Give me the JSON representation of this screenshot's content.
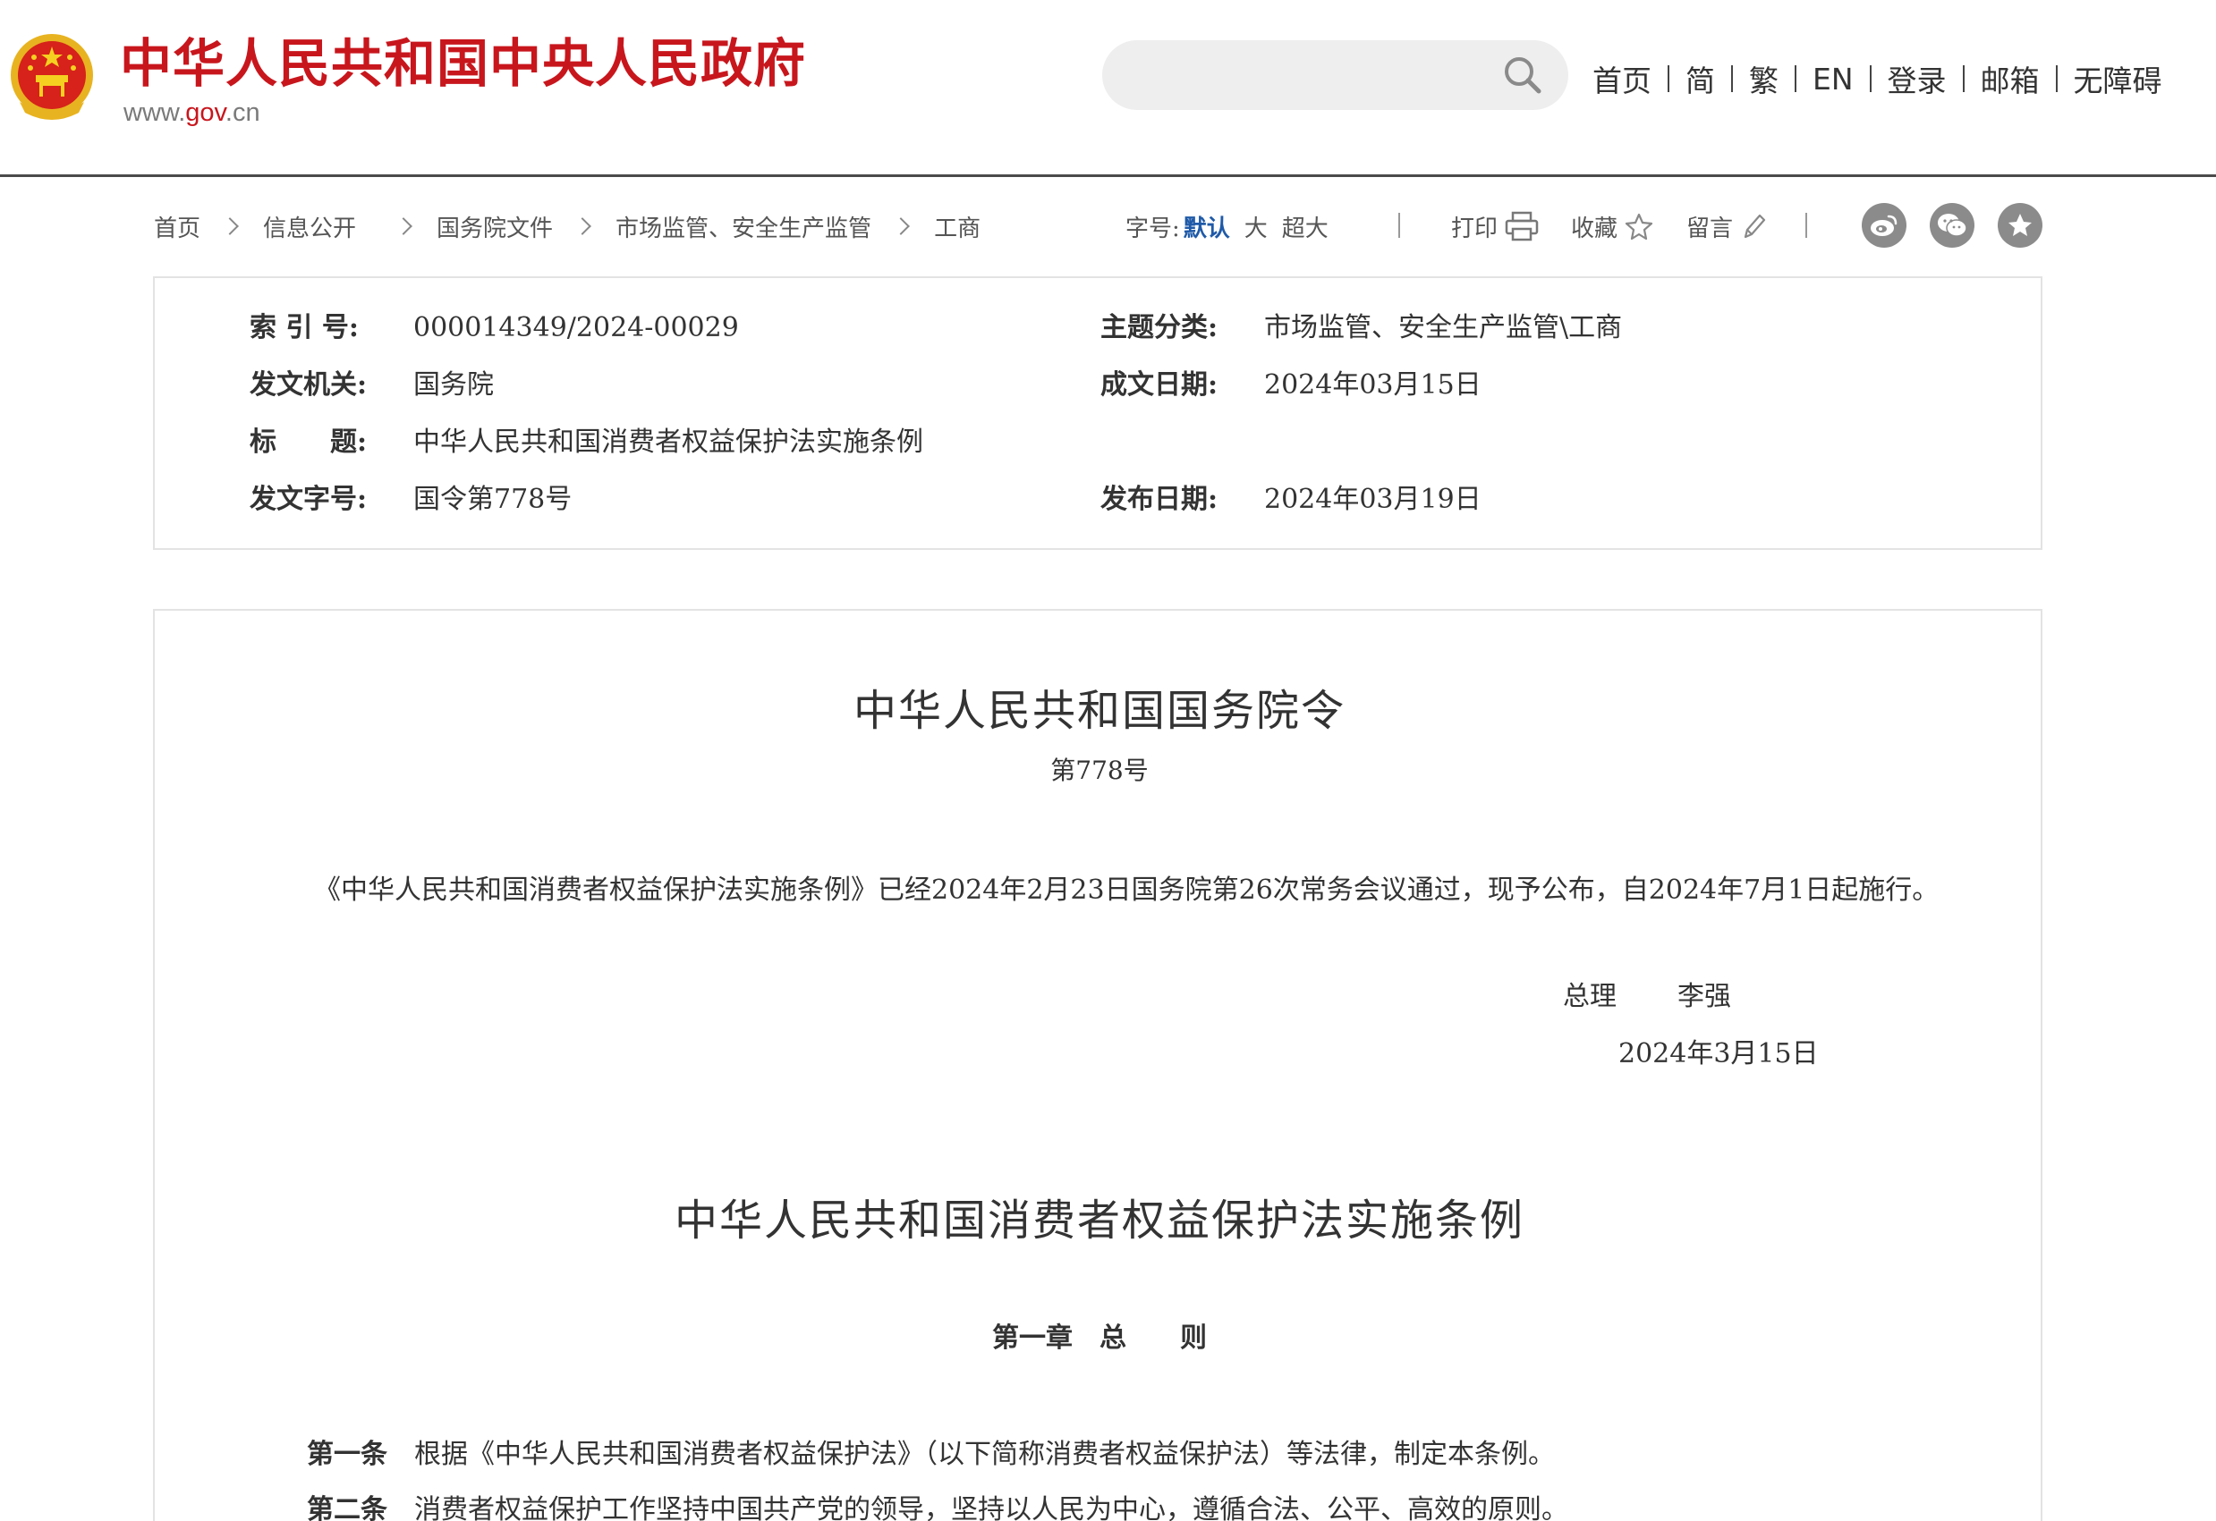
{
  "header": {
    "site_title": "中华人民共和国中央人民政府",
    "site_url_prefix": "www.",
    "site_url_gov": "gov",
    "site_url_suffix": ".cn",
    "brand_color": "#c8161d",
    "search": {
      "placeholder": "",
      "icon": "search-icon"
    },
    "nav": [
      "首页",
      "简",
      "繁",
      "EN",
      "登录",
      "邮箱",
      "无障碍"
    ]
  },
  "breadcrumb": [
    "首页",
    "信息公开",
    "国务院文件",
    "市场监管、安全生产监管",
    "工商"
  ],
  "toolbar": {
    "fontsize_label": "字号:",
    "fontsize_options": [
      "默认",
      "大",
      "超大"
    ],
    "fontsize_active": "默认",
    "print_label": "打印",
    "favorite_label": "收藏",
    "comment_label": "留言",
    "share_icons": [
      "weibo-icon",
      "wechat-icon",
      "favorite-star-icon"
    ],
    "active_color": "#1f5aa8"
  },
  "info": {
    "index_label": "索 引 号:",
    "index_value": "000014349/2024-00029",
    "topic_label": "主题分类:",
    "topic_value": "市场监管、安全生产监管\\工商",
    "issuer_label": "发文机关:",
    "issuer_value": "国务院",
    "written_date_label": "成文日期:",
    "written_date_value": "2024年03月15日",
    "title_label": "标　　题:",
    "title_value": "中华人民共和国消费者权益保护法实施条例",
    "doc_no_label": "发文字号:",
    "doc_no_value": "国令第778号",
    "publish_date_label": "发布日期:",
    "publish_date_value": "2024年03月19日"
  },
  "article": {
    "order_title": "中华人民共和国国务院令",
    "order_number": "第778号",
    "intro_paragraph": "《中华人民共和国消费者权益保护法实施条例》已经2024年2月23日国务院第26次常务会议通过，现予公布，自2024年7月1日起施行。",
    "signer_title": "总理",
    "signer_name": "李强",
    "sign_date": "2024年3月15日",
    "regulation_title": "中华人民共和国消费者权益保护法实施条例",
    "chapter_title": "第一章　总　　则",
    "articles": [
      {
        "no": "第一条",
        "text": "根据《中华人民共和国消费者权益保护法》（以下简称消费者权益保护法）等法律，制定本条例。"
      },
      {
        "no": "第二条",
        "text": "消费者权益保护工作坚持中国共产党的领导，坚持以人民为中心，遵循合法、公平、高效的原则。"
      }
    ]
  }
}
